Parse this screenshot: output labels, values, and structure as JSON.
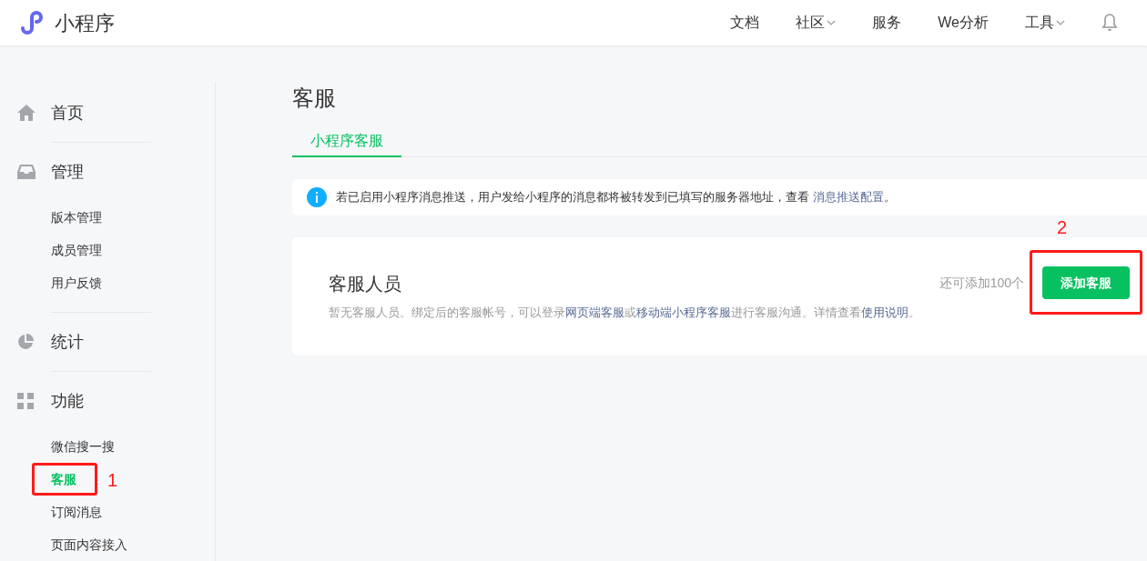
{
  "header": {
    "logo_text": "小程序",
    "nav": [
      {
        "label": "文档",
        "dropdown": false
      },
      {
        "label": "社区",
        "dropdown": true
      },
      {
        "label": "服务",
        "dropdown": false
      },
      {
        "label": "We分析",
        "dropdown": false
      },
      {
        "label": "工具",
        "dropdown": true
      }
    ]
  },
  "sidebar": {
    "sections": [
      {
        "label": "首页"
      },
      {
        "label": "管理",
        "items": [
          {
            "label": "版本管理",
            "selected": false
          },
          {
            "label": "成员管理",
            "selected": false
          },
          {
            "label": "用户反馈",
            "selected": false
          }
        ]
      },
      {
        "label": "统计"
      },
      {
        "label": "功能",
        "items": [
          {
            "label": "微信搜一搜",
            "selected": false
          },
          {
            "label": "客服",
            "selected": true,
            "annotation": "1"
          },
          {
            "label": "订阅消息",
            "selected": false
          },
          {
            "label": "页面内容接入",
            "selected": false
          }
        ]
      }
    ]
  },
  "page": {
    "title": "客服",
    "tabs": [
      {
        "label": "小程序客服",
        "selected": true
      }
    ],
    "notice": {
      "text": "若已启用小程序消息推送，用户发给小程序的消息都将被转发到已填写的服务器地址，查看 ",
      "link": "消息推送配置",
      "text_after": "。"
    },
    "card": {
      "title": "客服人员",
      "quota": "还可添加100个",
      "button": {
        "label": "添加客服",
        "annotation": "2"
      },
      "description": [
        {
          "text": "暂无客服人员。绑定后的客服帐号，可以登录"
        },
        {
          "link": "网页端客服"
        },
        {
          "text": "或"
        },
        {
          "link": "移动端小程序客服"
        },
        {
          "text": "进行客服沟通。详情查看"
        },
        {
          "link": "使用说明"
        },
        {
          "text": "。"
        }
      ]
    }
  }
}
